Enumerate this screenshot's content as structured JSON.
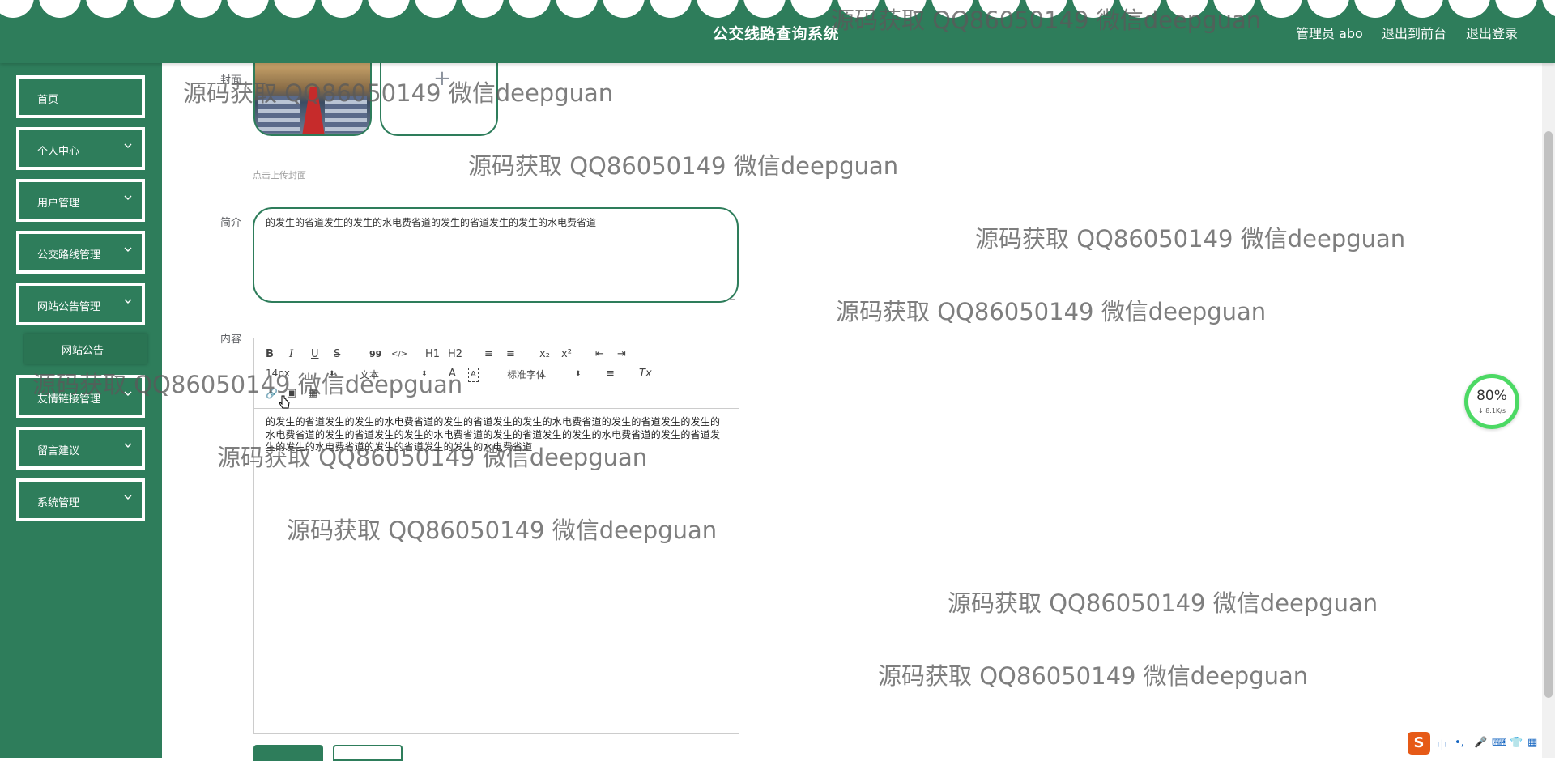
{
  "header": {
    "title": "公交线路查询系统",
    "user": "管理员 abo",
    "to_front": "退出到前台",
    "logout": "退出登录"
  },
  "colors": {
    "primary": "#2e7d5b",
    "accent": "#4cd964"
  },
  "sidebar": {
    "items": [
      {
        "label": "首页",
        "has_children": false
      },
      {
        "label": "个人中心",
        "has_children": true
      },
      {
        "label": "用户管理",
        "has_children": true
      },
      {
        "label": "公交路线管理",
        "has_children": true
      },
      {
        "label": "网站公告管理",
        "has_children": true
      },
      {
        "label": "友情链接管理",
        "has_children": true
      },
      {
        "label": "留言建议",
        "has_children": true
      },
      {
        "label": "系统管理",
        "has_children": true
      }
    ],
    "submenu": {
      "label": "网站公告"
    }
  },
  "form": {
    "cover_label": "封面",
    "upload_hint": "点击上传封面",
    "summary_label": "简介",
    "summary_value": "的发生的省道发生的发生的水电费省道的发生的省道发生的发生的水电费省道",
    "content_label": "内容",
    "content_value": "的发生的省道发生的发生的水电费省道的发生的省道发生的发生的水电费省道的发生的省道发生的发生的水电费省道的发生的省道发生的发生的水电费省道的发生的省道发生的发生的水电费省道的发生的省道发生的发生的水电费省道的发生的省道发生的发生的水电费省道",
    "toolbar": {
      "bold": "B",
      "italic": "I",
      "underline": "U",
      "strike": "S",
      "quote": "99",
      "code": "</>",
      "h1": "H1",
      "h2": "H2",
      "ol": "≡",
      "ul": "≡",
      "sub": "x₂",
      "sup": "x²",
      "outdent": "⇤",
      "indent": "⇥",
      "size": "14px",
      "text_style": "文本",
      "color": "A",
      "background": "A",
      "font": "标准字体",
      "align": "≡",
      "clean": "Tx",
      "link": "🔗",
      "image": "▣",
      "video": "▦"
    }
  },
  "watermark": "源码获取 QQ86050149 微信deepguan",
  "speed_widget": {
    "percent": "80%",
    "rate": "↓ 8.1K/s"
  },
  "ime": {
    "logo": "S",
    "lang": "中",
    "punct": "•,",
    "mic": "🎤",
    "keyboard": "⌨",
    "skin": "👕",
    "menu": "▦"
  }
}
